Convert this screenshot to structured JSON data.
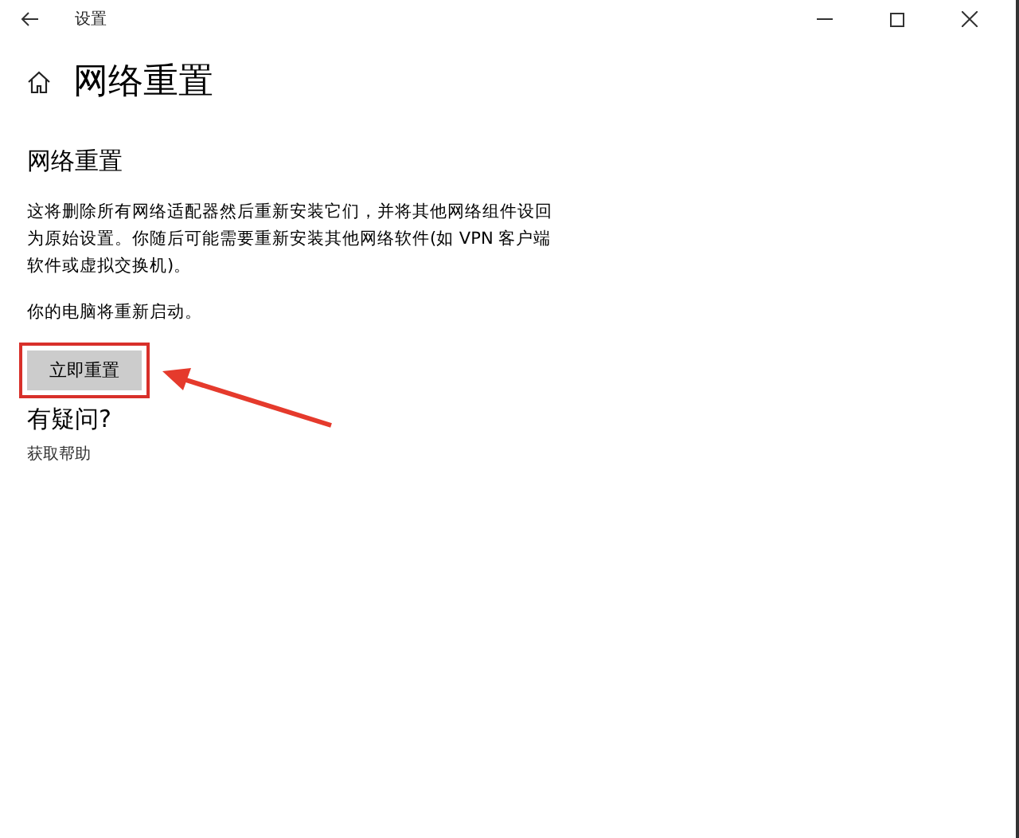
{
  "window": {
    "title": "设置"
  },
  "page": {
    "title": "网络重置"
  },
  "section": {
    "heading": "网络重置",
    "description": "这将删除所有网络适配器然后重新安装它们，并将其他网络组件设回为原始设置。你随后可能需要重新安装其他网络软件(如 VPN 客户端软件或虚拟交换机)。",
    "note": "你的电脑将重新启动。",
    "button": "立即重置"
  },
  "help": {
    "heading": "有疑问?",
    "link": "获取帮助"
  }
}
